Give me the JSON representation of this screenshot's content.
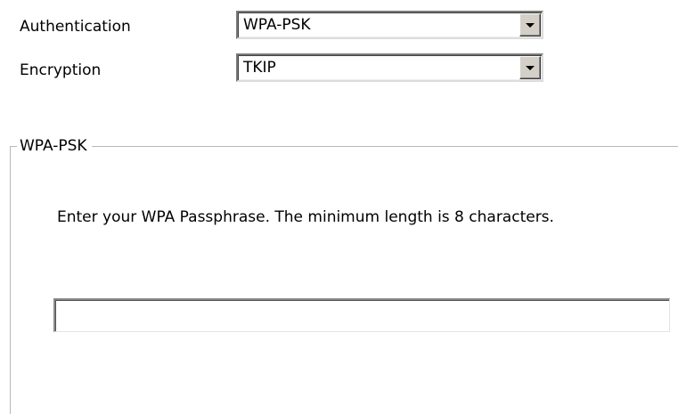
{
  "authentication": {
    "label": "Authentication",
    "selected": "WPA-PSK"
  },
  "encryption": {
    "label": "Encryption",
    "selected": "TKIP"
  },
  "wpa_group": {
    "title": "WPA-PSK",
    "instructions": "Enter your WPA Passphrase.  The minimum length is 8 characters.",
    "passphrase_value": ""
  },
  "icons": {
    "dropdown": "chevron-down-icon"
  }
}
